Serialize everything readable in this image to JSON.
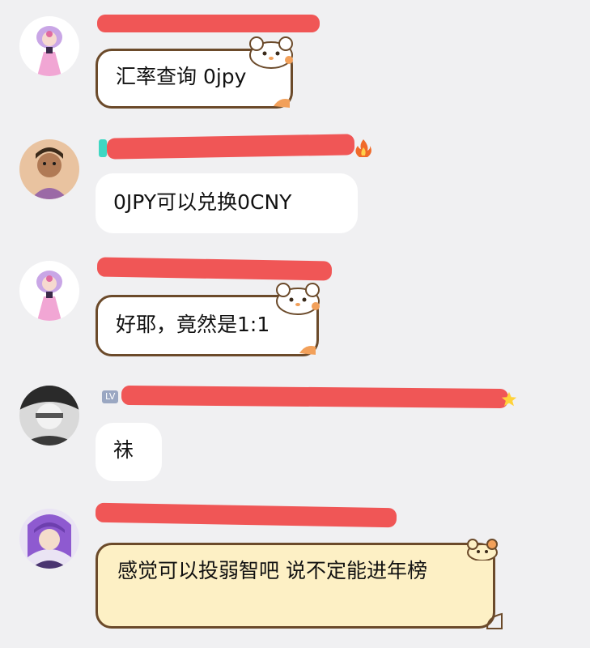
{
  "chat": {
    "messages": [
      {
        "level": "",
        "text": "汇率查询 0jpy"
      },
      {
        "level": "",
        "text": "0JPY可以兑换0CNY"
      },
      {
        "level": "",
        "text": "好耶，竟然是1:1"
      },
      {
        "level": "LV",
        "text": "祙"
      },
      {
        "level": "",
        "text": "感觉可以投弱智吧 说不定能进年榜"
      }
    ]
  },
  "icons": {
    "fire": "fire-icon",
    "star": "star-icon",
    "cat_sticker": "hamster-sticker-icon"
  },
  "colors": {
    "background": "#f0f0f2",
    "redaction": "#ef4d4d",
    "bubble": "#ffffff",
    "yellow_bubble": "#fdf0c5",
    "frame": "#6b4a2a"
  }
}
